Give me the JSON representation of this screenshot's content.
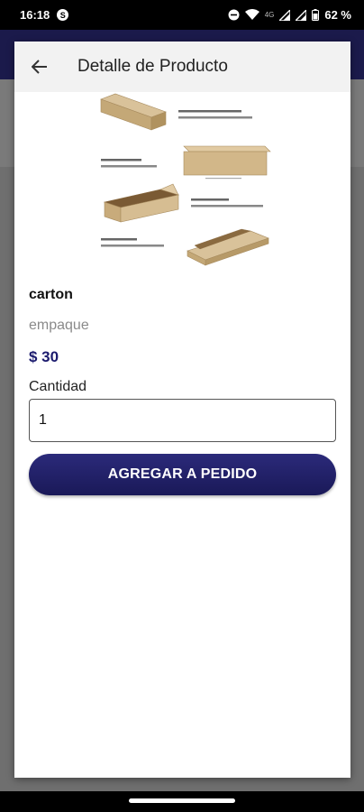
{
  "status_bar": {
    "time": "16:18",
    "notification_icon": "s-badge-icon",
    "network_label": "4G",
    "battery": "62 %"
  },
  "dialog": {
    "title": "Detalle de Producto",
    "back_icon": "arrow-left-icon"
  },
  "product": {
    "image_label": "product-image-boxes",
    "name": "carton",
    "category": "empaque",
    "price": "$ 30"
  },
  "quantity": {
    "label": "Cantidad",
    "value": "1"
  },
  "actions": {
    "add_label": "AGREGAR A PEDIDO"
  },
  "colors": {
    "primary": "#1c1b6e",
    "header_bg": "#1b1a4b"
  }
}
